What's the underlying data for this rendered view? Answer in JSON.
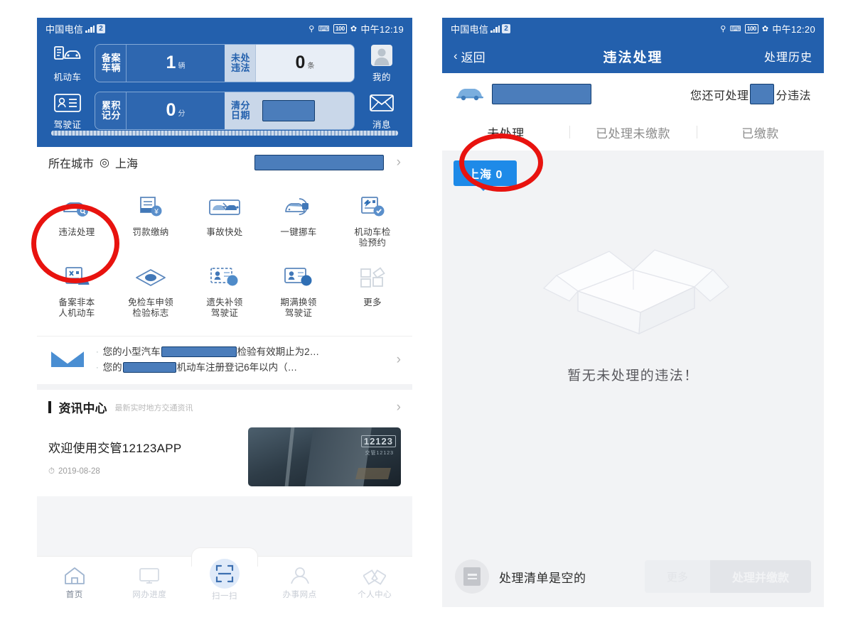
{
  "left": {
    "statusbar": {
      "carrier": "中国电信",
      "hd_badge": "2",
      "battery": "100",
      "time": "中午12:19",
      "icons": [
        "location-pin-icon",
        "vibrate-icon",
        "battery-icon",
        "leaf-icon"
      ]
    },
    "header": {
      "side_left": [
        {
          "label": "机动车",
          "icon": "vehicle-icon"
        },
        {
          "label": "驾驶证",
          "icon": "driver-license-icon"
        }
      ],
      "side_right": [
        {
          "label": "我的",
          "icon": "avatar-icon"
        },
        {
          "label": "消息",
          "icon": "envelope-icon"
        }
      ],
      "stats": [
        {
          "label": "备案\n车辆",
          "label1": "备案",
          "label2": "车辆",
          "value": "1",
          "unit": "辆",
          "label_b1": "未处",
          "label_b2": "违法",
          "value_b": "0",
          "unit_b": "条"
        },
        {
          "label1": "累积",
          "label2": "记分",
          "value": "0",
          "unit": "分",
          "label_b1": "清分",
          "label_b2": "日期",
          "value_b": "",
          "unit_b": ""
        }
      ]
    },
    "city_row": {
      "label": "所在城市",
      "city": "上海",
      "icon": "crosshair-icon"
    },
    "grid": [
      {
        "label1": "违法处理",
        "label2": "",
        "icon": "car-violation-icon"
      },
      {
        "label1": "罚款缴纳",
        "label2": "",
        "icon": "payment-doc-icon"
      },
      {
        "label1": "事故快处",
        "label2": "",
        "icon": "accident-icon"
      },
      {
        "label1": "一键挪车",
        "label2": "",
        "icon": "move-car-icon"
      },
      {
        "label1": "机动车检",
        "label2": "验预约",
        "icon": "inspection-icon"
      },
      {
        "label1": "备案非本",
        "label2": "人机动车",
        "icon": "register-other-icon"
      },
      {
        "label1": "免检车申领",
        "label2": "检验标志",
        "icon": "exempt-mark-icon"
      },
      {
        "label1": "遗失补领",
        "label2": "驾驶证",
        "icon": "reissue-license-icon"
      },
      {
        "label1": "期满换领",
        "label2": "驾驶证",
        "icon": "renew-license-icon"
      },
      {
        "label1": "更多",
        "label2": "",
        "icon": "more-grid-icon"
      }
    ],
    "notice": {
      "icon": "mail-icon",
      "line1_a": "您的小型汽车",
      "line1_b": "检验有效期止为2…",
      "line2_a": "您的",
      "line2_b": "机动车注册登记6年以内（…"
    },
    "news": {
      "title": "资讯中心",
      "subtitle": "最新实时地方交通资讯",
      "headline": "欢迎使用交管12123APP",
      "date": "2019-08-28",
      "clock_icon": "clock-icon",
      "thumb_logo": "12123",
      "thumb_sub": "交管12123"
    },
    "tabbar": [
      {
        "label": "首页",
        "icon": "home-icon",
        "active": true
      },
      {
        "label": "网办进度",
        "icon": "monitor-icon",
        "active": false
      },
      {
        "label": "扫一扫",
        "icon": "scan-icon",
        "active": false
      },
      {
        "label": "办事网点",
        "icon": "location-icon",
        "active": false
      },
      {
        "label": "个人中心",
        "icon": "profile-icon",
        "active": false
      }
    ]
  },
  "right": {
    "statusbar": {
      "carrier": "中国电信",
      "hd_badge": "2",
      "battery": "100",
      "time": "中午12:20"
    },
    "navbar": {
      "back": "返回",
      "back_icon": "chevron-left-icon",
      "title": "违法处理",
      "history": "处理历史"
    },
    "plate_row": {
      "icon": "car-icon",
      "quota_prefix": "您还可处理",
      "quota_suffix": "分违法"
    },
    "tabs": [
      {
        "label": "未处理",
        "selected": true
      },
      {
        "label": "已处理未缴款",
        "selected": false
      },
      {
        "label": "已缴款",
        "selected": false
      }
    ],
    "city_badge": "上海 0",
    "empty": {
      "icon": "empty-box-icon",
      "message": "暂无未处理的违法！"
    },
    "bottom": {
      "cart_icon": "list-icon",
      "cart_text": "处理清单是空的",
      "btn_secondary": "更多",
      "btn_primary": "处理并缴款"
    }
  },
  "annotations": {
    "circle_color": "#e8130f",
    "circles": [
      {
        "name": "violation-handling-highlight",
        "target": "违法处理"
      },
      {
        "name": "unprocessed-tab-highlight",
        "target": "未处理"
      }
    ]
  }
}
